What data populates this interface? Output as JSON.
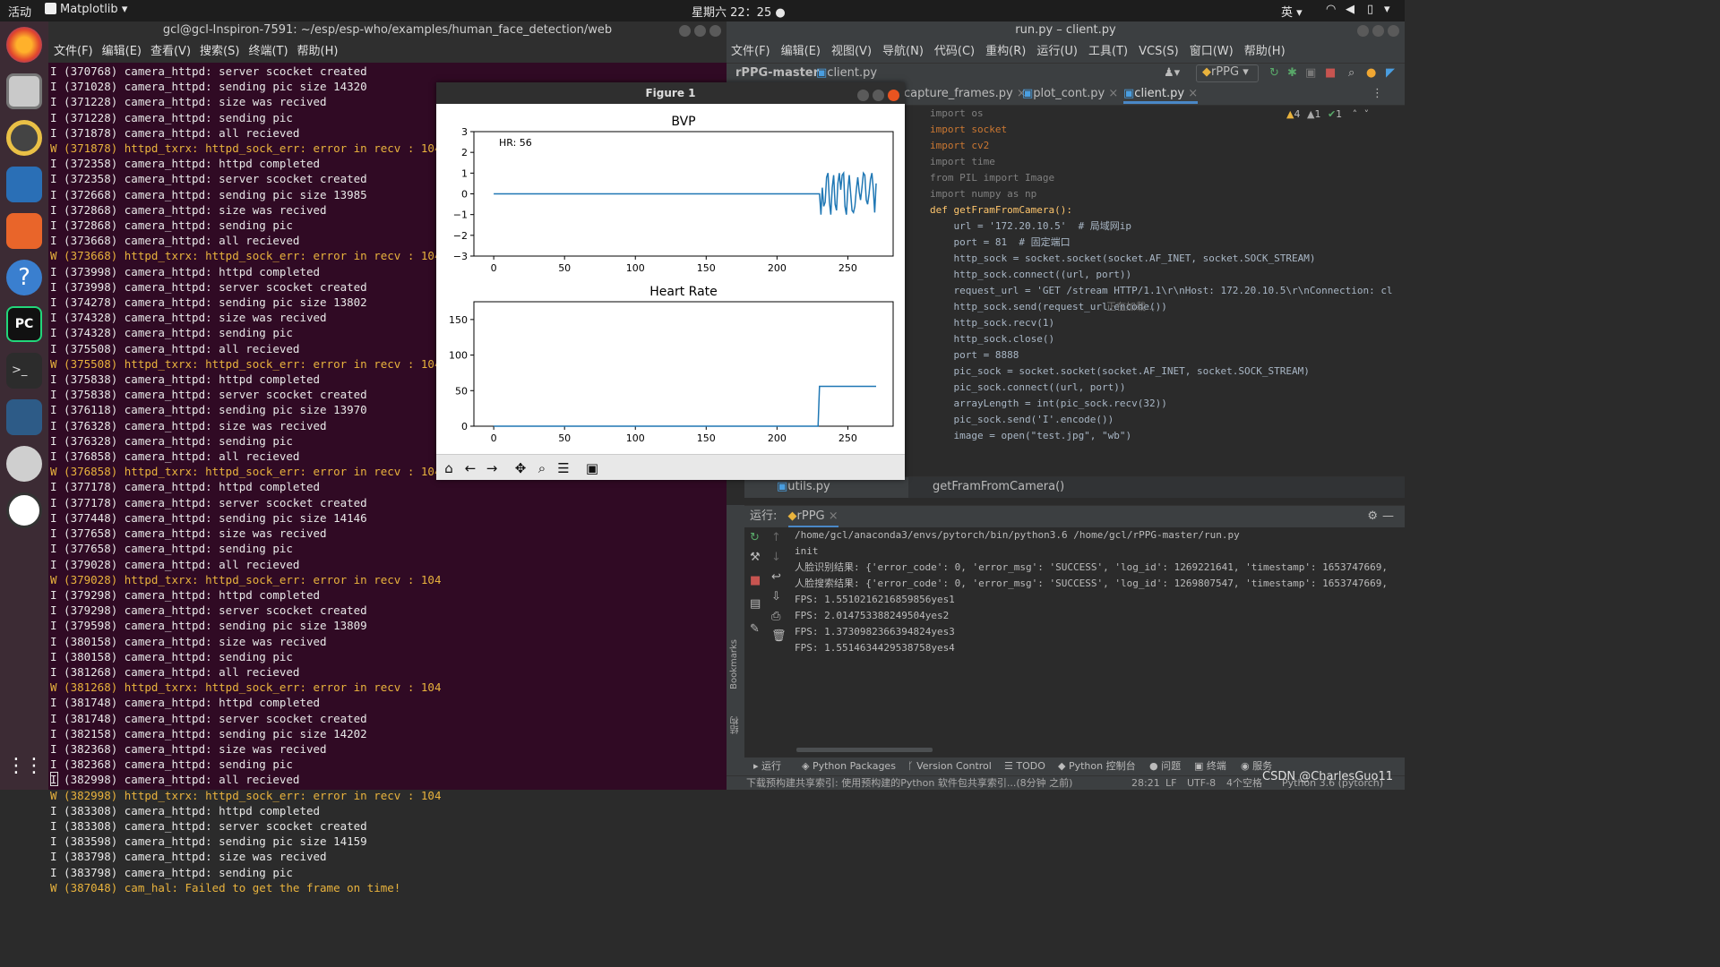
{
  "topbar": {
    "activities": "活动",
    "app_name": "Matplotlib",
    "clock": "星期六 22：25",
    "ime": "英"
  },
  "terminal": {
    "title": "gcl@gcl-Inspiron-7591: ~/esp/esp-who/examples/human_face_detection/web",
    "menu": [
      "文件(F)",
      "编辑(E)",
      "查看(V)",
      "搜索(S)",
      "终端(T)",
      "帮助(H)"
    ],
    "lines": [
      {
        "t": "I",
        "text": "I (370768) camera_httpd: server scocket created"
      },
      {
        "t": "I",
        "text": "I (371028) camera_httpd: sending pic size 14320"
      },
      {
        "t": "I",
        "text": "I (371228) camera_httpd: size was recived"
      },
      {
        "t": "I",
        "text": "I (371228) camera_httpd: sending pic"
      },
      {
        "t": "I",
        "text": "I (371878) camera_httpd: all recieved"
      },
      {
        "t": "W",
        "text": "W (371878) httpd_txrx: httpd_sock_err: error in recv : 104"
      },
      {
        "t": "I",
        "text": "I (372358) camera_httpd: httpd completed"
      },
      {
        "t": "I",
        "text": "I (372358) camera_httpd: server scocket created"
      },
      {
        "t": "I",
        "text": "I (372668) camera_httpd: sending pic size 13985"
      },
      {
        "t": "I",
        "text": "I (372868) camera_httpd: size was recived"
      },
      {
        "t": "I",
        "text": "I (372868) camera_httpd: sending pic"
      },
      {
        "t": "I",
        "text": "I (373668) camera_httpd: all recieved"
      },
      {
        "t": "W",
        "text": "W (373668) httpd_txrx: httpd_sock_err: error in recv : 104"
      },
      {
        "t": "I",
        "text": "I (373998) camera_httpd: httpd completed"
      },
      {
        "t": "I",
        "text": "I (373998) camera_httpd: server scocket created"
      },
      {
        "t": "I",
        "text": "I (374278) camera_httpd: sending pic size 13802"
      },
      {
        "t": "I",
        "text": "I (374328) camera_httpd: size was recived"
      },
      {
        "t": "I",
        "text": "I (374328) camera_httpd: sending pic"
      },
      {
        "t": "I",
        "text": "I (375508) camera_httpd: all recieved"
      },
      {
        "t": "W",
        "text": "W (375508) httpd_txrx: httpd_sock_err: error in recv : 104"
      },
      {
        "t": "I",
        "text": "I (375838) camera_httpd: httpd completed"
      },
      {
        "t": "I",
        "text": "I (375838) camera_httpd: server scocket created"
      },
      {
        "t": "I",
        "text": "I (376118) camera_httpd: sending pic size 13970"
      },
      {
        "t": "I",
        "text": "I (376328) camera_httpd: size was recived"
      },
      {
        "t": "I",
        "text": "I (376328) camera_httpd: sending pic"
      },
      {
        "t": "I",
        "text": "I (376858) camera_httpd: all recieved"
      },
      {
        "t": "W",
        "text": "W (376858) httpd_txrx: httpd_sock_err: error in recv : 104"
      },
      {
        "t": "I",
        "text": "I (377178) camera_httpd: httpd completed"
      },
      {
        "t": "I",
        "text": "I (377178) camera_httpd: server scocket created"
      },
      {
        "t": "I",
        "text": "I (377448) camera_httpd: sending pic size 14146"
      },
      {
        "t": "I",
        "text": "I (377658) camera_httpd: size was recived"
      },
      {
        "t": "I",
        "text": "I (377658) camera_httpd: sending pic"
      },
      {
        "t": "I",
        "text": "I (379028) camera_httpd: all recieved"
      },
      {
        "t": "W",
        "text": "W (379028) httpd_txrx: httpd_sock_err: error in recv : 104"
      },
      {
        "t": "I",
        "text": "I (379298) camera_httpd: httpd completed"
      },
      {
        "t": "I",
        "text": "I (379298) camera_httpd: server scocket created"
      },
      {
        "t": "I",
        "text": "I (379598) camera_httpd: sending pic size 13809"
      },
      {
        "t": "I",
        "text": "I (380158) camera_httpd: size was recived"
      },
      {
        "t": "I",
        "text": "I (380158) camera_httpd: sending pic"
      },
      {
        "t": "I",
        "text": "I (381268) camera_httpd: all recieved"
      },
      {
        "t": "W",
        "text": "W (381268) httpd_txrx: httpd_sock_err: error in recv : 104"
      },
      {
        "t": "I",
        "text": "I (381748) camera_httpd: httpd completed"
      },
      {
        "t": "I",
        "text": "I (381748) camera_httpd: server scocket created"
      },
      {
        "t": "I",
        "text": "I (382158) camera_httpd: sending pic size 14202"
      },
      {
        "t": "I",
        "text": "I (382368) camera_httpd: size was recived"
      },
      {
        "t": "I",
        "text": "I (382368) camera_httpd: sending pic"
      },
      {
        "t": "I",
        "text": "I (382998) camera_httpd: all recieved"
      },
      {
        "t": "W",
        "text": "W (382998) httpd_txrx: httpd_sock_err: error in recv : 104"
      },
      {
        "t": "I",
        "text": "I (383308) camera_httpd: httpd completed"
      },
      {
        "t": "I",
        "text": "I (383308) camera_httpd: server scocket created"
      },
      {
        "t": "I",
        "text": "I (383598) camera_httpd: sending pic size 14159"
      },
      {
        "t": "I",
        "text": "I (383798) camera_httpd: size was recived"
      },
      {
        "t": "I",
        "text": "I (383798) camera_httpd: sending pic"
      },
      {
        "t": "W",
        "text": "W (387048) cam_hal: Failed to get the frame on time!"
      }
    ]
  },
  "ide": {
    "title": "run.py – client.py",
    "menu": [
      "文件(F)",
      "编辑(E)",
      "视图(V)",
      "导航(N)",
      "代码(C)",
      "重构(R)",
      "运行(U)",
      "工具(T)",
      "VCS(S)",
      "窗口(W)",
      "帮助(H)"
    ],
    "breadcrumb_project": "rPPG-master",
    "breadcrumb_file": "client.py",
    "run_config": "rPPG",
    "tabs": [
      "capture_frames.py",
      "plot_cont.py",
      "client.py"
    ],
    "inspections": {
      "warn": "4",
      "weak": "1",
      "ok": "1"
    },
    "code_lines": [
      "import os",
      "import socket",
      "import cv2",
      "import time",
      "from PIL import Image",
      "import numpy as np",
      "",
      "",
      "def getFramFromCamera():",
      "    url = '172.20.10.5'  # 局域网ip",
      "    port = 81  # 固定端口",
      "    http_sock = socket.socket(socket.AF_INET, socket.SOCK_STREAM)",
      "    http_sock.connect((url, port))",
      "    request_url = 'GET /stream HTTP/1.1\\r\\nHost: 172.20.10.5\\r\\nConnection: cl",
      "    http_sock.send(request_url.encode())",
      "    http_sock.recv(1)",
      "    http_sock.close()",
      "",
      "    port = 8888",
      "    pic_sock = socket.socket(socket.AF_INET, socket.SOCK_STREAM)",
      "    pic_sock.connect((url, port))",
      "    arrayLength = int(pic_sock.recv(32))",
      "    pic_sock.send('I'.encode())",
      "    image = open(\"test.jpg\", \"wb\")"
    ],
    "loading": "正在加载...",
    "left_file": "utils.py",
    "crumb_fn": "getFramFromCamera()",
    "run_label": "运行:",
    "run_tab": "rPPG",
    "run_output": [
      "/home/gcl/anaconda3/envs/pytorch/bin/python3.6 /home/gcl/rPPG-master/run.py",
      "init",
      "人脸识别结果: {'error_code': 0, 'error_msg': 'SUCCESS', 'log_id': 1269221641, 'timestamp': 1653747669,",
      "人脸搜索结果: {'error_code': 0, 'error_msg': 'SUCCESS', 'log_id': 1269807547, 'timestamp': 1653747669,",
      "FPS: 1.5510216216859856yes1",
      "FPS: 2.014753388249504yes2",
      "FPS: 1.3730982366394824yes3",
      "FPS: 1.5514634429538758yes4"
    ],
    "side_labels": {
      "bookmarks": "Bookmarks",
      "structure": "结构"
    },
    "bottom_tabs": [
      "运行",
      "Python Packages",
      "Version Control",
      "TODO",
      "Python 控制台",
      "问题",
      "终端",
      "服务"
    ],
    "status": {
      "msg": "下载预构建共享索引: 使用预构建的Python 软件包共享索引...(8分钟 之前)",
      "pos": "28:21",
      "lf": "LF",
      "enc": "UTF-8",
      "indent": "4个空格",
      "interp": "Python 3.6 (pytorch)"
    },
    "watermark": "CSDN @CharlesGuo11"
  },
  "figure": {
    "title": "Figure 1",
    "toolbar": [
      "home-icon",
      "back-icon",
      "forward-icon",
      "pan-icon",
      "zoom-icon",
      "configure-icon",
      "save-icon"
    ]
  },
  "chart_data": [
    {
      "type": "line",
      "title": "BVP",
      "annotation": "HR: 56",
      "xlim": [
        -14,
        282
      ],
      "ylim": [
        -3,
        3
      ],
      "xticks": [
        0,
        50,
        100,
        150,
        200,
        250
      ],
      "yticks": [
        3,
        2,
        1,
        0,
        -1,
        -2,
        -3
      ],
      "x": [
        0,
        230,
        231,
        232,
        233,
        234,
        235,
        236,
        237,
        238,
        239,
        240,
        241,
        242,
        243,
        244,
        245,
        246,
        247,
        248,
        249,
        250,
        251,
        252,
        253,
        254,
        255,
        256,
        257,
        258,
        259,
        260,
        261,
        262,
        263,
        264,
        265,
        266,
        267,
        268,
        269,
        270
      ],
      "y": [
        0,
        0,
        -1,
        0.3,
        -0.6,
        -0.4,
        0.8,
        1.0,
        -0.4,
        -1.0,
        0.3,
        0.9,
        -0.5,
        -0.8,
        0.5,
        1.0,
        0.2,
        0.9,
        1.0,
        -0.6,
        -1.0,
        0.2,
        0.9,
        0.0,
        -0.8,
        -0.9,
        -0.6,
        0.2,
        0.8,
        0.1,
        -0.3,
        0.3,
        1.0,
        0.9,
        -0.3,
        -0.5,
        0.0,
        0.7,
        1.0,
        0.2,
        -0.9,
        0.5
      ]
    },
    {
      "type": "line",
      "title": "Heart Rate",
      "xlim": [
        -14,
        282
      ],
      "ylim": [
        0,
        175
      ],
      "xticks": [
        0,
        50,
        100,
        150,
        200,
        250
      ],
      "yticks": [
        150,
        100,
        50,
        0
      ],
      "x": [
        0,
        229,
        230,
        270
      ],
      "y": [
        0,
        0,
        56,
        56
      ]
    }
  ]
}
